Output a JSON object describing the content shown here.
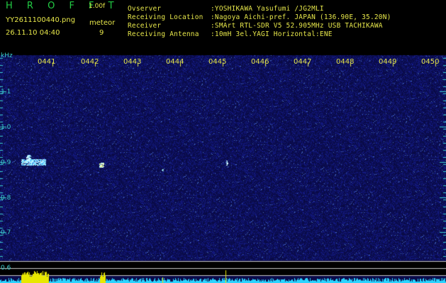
{
  "header": {
    "brand": "H R O F F T",
    "version": "1.00f",
    "filename": "YY2611100440.png",
    "datetime": "26.11.10 04:40",
    "meteor_label": "meteor",
    "meteor_count": "9",
    "fields": [
      {
        "label": "Ovserver",
        "value": ":YOSHIKAWA Yasufumi /JG2MLI"
      },
      {
        "label": "Receiving Location",
        "value": ":Nagoya Aichi-pref. JAPAN (136.90E, 35.20N)"
      },
      {
        "label": "Receiver",
        "value": ":SMArt RTL-SDR V5 52.905MHz USB TACHIKAWA"
      },
      {
        "label": "Receiving Antenna",
        "value": ":10mH 3el.YAGI Horizontal:ENE"
      }
    ]
  },
  "spectrogram": {
    "unit_label": "kHz",
    "time_labels": [
      "0441",
      "0442",
      "0443",
      "0444",
      "0445",
      "0446",
      "0447",
      "0448",
      "0449",
      "0450"
    ],
    "freq_labels": [
      "1.1",
      "1.0",
      "0.9",
      "0.8",
      "0.7",
      "0.6"
    ],
    "background_color": "#0a0a4a",
    "tick_color": "#3bcfcf",
    "label_color": "#e6e64a"
  },
  "chart_data": {
    "type": "heatmap",
    "x_labels": [
      "0441",
      "0442",
      "0443",
      "0444",
      "0445",
      "0446",
      "0447",
      "0448",
      "0449",
      "0450"
    ],
    "y_labels": [
      "1.1",
      "1.0",
      "0.9",
      "0.8",
      "0.7",
      "0.6"
    ],
    "ylabel": "kHz",
    "meteor_echoes": [
      {
        "time": "0440:30",
        "freq_khz": 0.9
      },
      {
        "time": "0442:25",
        "freq_khz": 0.89
      },
      {
        "time": "0443:55",
        "freq_khz": 0.88
      },
      {
        "time": "0445:25",
        "freq_khz": 0.9
      }
    ]
  }
}
